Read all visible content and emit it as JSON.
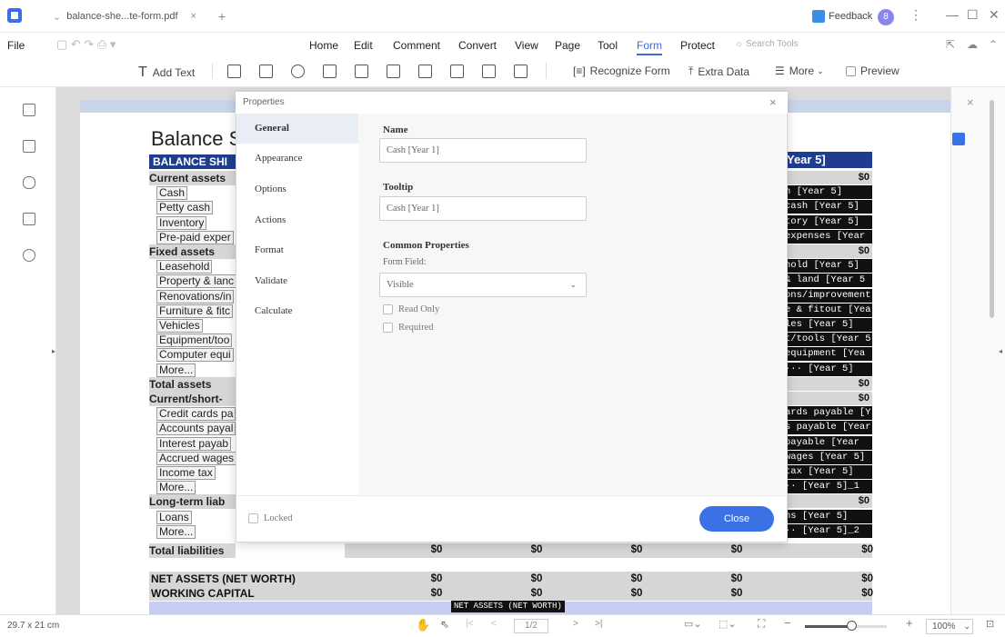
{
  "titlebar": {
    "tab_label": "balance-she...te-form.pdf",
    "tab_close": "×",
    "new_tab": "+",
    "feedback": "Feedback",
    "avatar_initial": "8",
    "more": "⋮",
    "minimize": "—",
    "maximize": "☐",
    "close": "✕"
  },
  "menu": {
    "file": "File",
    "items": [
      "Home",
      "Edit",
      "Comment",
      "Convert",
      "View",
      "Page",
      "Tool",
      "Form",
      "Protect"
    ],
    "active": "Form",
    "search_placeholder": "Search Tools"
  },
  "toolbar": {
    "add_text": "Add Text",
    "recognize_form": "Recognize Form",
    "extra_data": "Extra Data",
    "more": "More",
    "preview": "Preview"
  },
  "document": {
    "title": "Balance S",
    "header": "BALANCE SHI",
    "year_header": "Year 5]",
    "left_rows": [
      {
        "label": "Current assets",
        "style": "bold"
      },
      {
        "label": "Cash",
        "style": "indent"
      },
      {
        "label": "Petty cash",
        "style": "indent"
      },
      {
        "label": "Inventory",
        "style": "indent"
      },
      {
        "label": "Pre-paid exper",
        "style": "indent"
      },
      {
        "label": "Fixed assets",
        "style": "bold"
      },
      {
        "label": "Leasehold",
        "style": "indent"
      },
      {
        "label": "Property & lanc",
        "style": "indent"
      },
      {
        "label": "Renovations/in",
        "style": "indent"
      },
      {
        "label": "Furniture & fitc",
        "style": "indent"
      },
      {
        "label": "Vehicles",
        "style": "indent"
      },
      {
        "label": "Equipment/too",
        "style": "indent"
      },
      {
        "label": "Computer equi",
        "style": "indent"
      },
      {
        "label": "More...",
        "style": "indent"
      },
      {
        "label": "Total assets",
        "style": "bold"
      },
      {
        "label": "Current/short-",
        "style": "bold"
      },
      {
        "label": "Credit cards pa",
        "style": "indent"
      },
      {
        "label": "Accounts payal",
        "style": "indent"
      },
      {
        "label": "Interest payab",
        "style": "indent"
      },
      {
        "label": "Accrued wages",
        "style": "indent"
      },
      {
        "label": "Income tax",
        "style": "indent"
      },
      {
        "label": "More...",
        "style": "indent"
      },
      {
        "label": "Long-term liab",
        "style": "bold"
      },
      {
        "label": "Loans",
        "style": "indent"
      },
      {
        "label": "More...",
        "style": "indent"
      }
    ],
    "right_cells": [
      {
        "text": "$0",
        "style": "grey"
      },
      {
        "text": "h [Year 5]",
        "style": "dark"
      },
      {
        "text": "cash [Year 5]",
        "style": "dark"
      },
      {
        "text": "tory [Year 5]",
        "style": "dark"
      },
      {
        "text": "expenses [Year",
        "style": "dark"
      },
      {
        "text": "$0",
        "style": "grey"
      },
      {
        "text": "hold [Year 5]",
        "style": "dark"
      },
      {
        "text": "& land [Year 5",
        "style": "dark"
      },
      {
        "text": "ons/improvement",
        "style": "dark"
      },
      {
        "text": "e & fitout [Yea",
        "style": "dark"
      },
      {
        "text": "les [Year 5]",
        "style": "dark"
      },
      {
        "text": "t/tools [Year 5",
        "style": "dark"
      },
      {
        "text": "equipment [Yea",
        "style": "dark"
      },
      {
        "text": "··· [Year 5]",
        "style": "dark"
      },
      {
        "text": "$0",
        "style": "grey"
      },
      {
        "text": "$0",
        "style": "grey"
      },
      {
        "text": "ards payable [Y",
        "style": "dark"
      },
      {
        "text": "s payable [Year",
        "style": "dark"
      },
      {
        "text": "payable [Year",
        "style": "dark"
      },
      {
        "text": "wages [Year 5]",
        "style": "dark"
      },
      {
        "text": "tax [Year 5]",
        "style": "dark"
      },
      {
        "text": "·· [Year 5]_1",
        "style": "dark"
      },
      {
        "text": "$0",
        "style": "grey"
      },
      {
        "text": "ns [Year 5]",
        "style": "dark"
      },
      {
        "text": "·· [Year 5]_2",
        "style": "dark"
      }
    ],
    "total_liabilities": "Total liabilities",
    "net_assets": "NET ASSETS (NET WORTH)",
    "working_capital": "WORKING CAPITAL",
    "zero": "$0",
    "net_assets_field": "NET ASSETS (NET WORTH)"
  },
  "dialog": {
    "title": "Properties",
    "close": "×",
    "nav": [
      "General",
      "Appearance",
      "Options",
      "Actions",
      "Format",
      "Validate",
      "Calculate"
    ],
    "active_nav": "General",
    "name_label": "Name",
    "name_value": "Cash [Year 1]",
    "tooltip_label": "Tooltip",
    "tooltip_value": "Cash [Year 1]",
    "common_label": "Common Properties",
    "form_field_label": "Form Field:",
    "form_field_value": "Visible",
    "read_only": "Read Only",
    "required": "Required",
    "locked": "Locked",
    "close_button": "Close"
  },
  "status": {
    "page_size": "29.7 x 21 cm",
    "page_indicator": "1/2",
    "zoom": "100%",
    "zoom_fraction": 0.55
  }
}
